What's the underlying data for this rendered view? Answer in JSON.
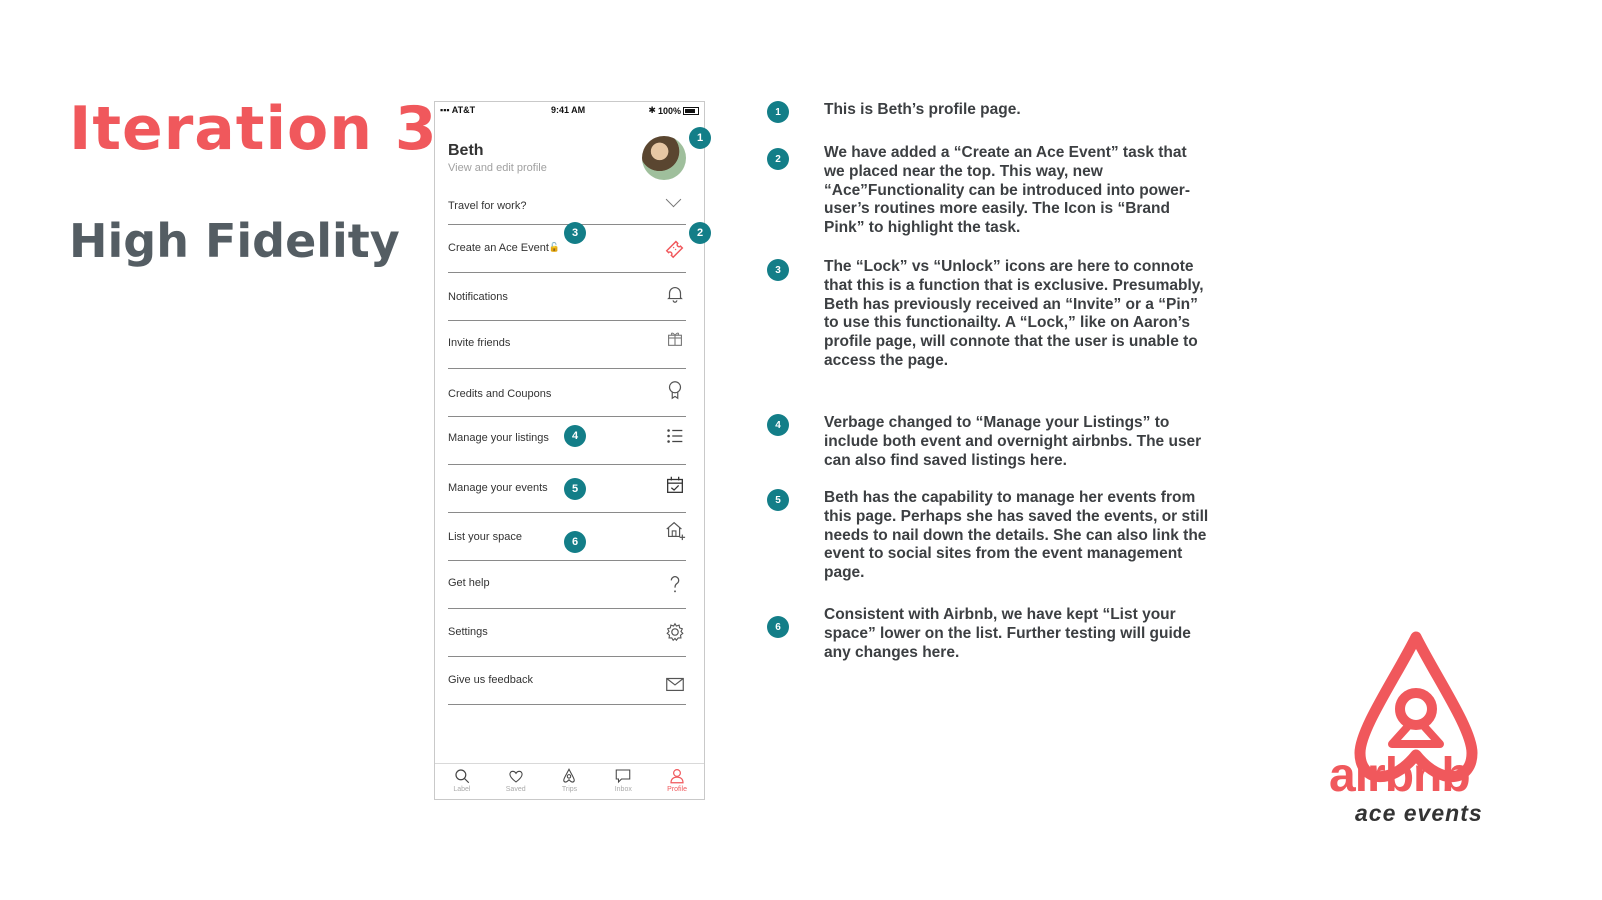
{
  "slide": {
    "title": "Iteration 3",
    "subtitle": "High Fidelity"
  },
  "phone": {
    "status": {
      "carrier": "AT&T",
      "time": "9:41 AM",
      "battery": "100%"
    },
    "profile": {
      "name": "Beth",
      "subtitle": "View and edit profile"
    },
    "travel_label": "Travel for work?",
    "menu": [
      {
        "label": "Create an Ace Event",
        "icon": "ticket-icon"
      },
      {
        "label": "Notifications",
        "icon": "bell-icon"
      },
      {
        "label": "Invite friends",
        "icon": "gift-icon"
      },
      {
        "label": "Credits and Coupons",
        "icon": "award-icon"
      },
      {
        "label": "Manage your listings",
        "icon": "list-icon"
      },
      {
        "label": "Manage your events",
        "icon": "calendar-check-icon"
      },
      {
        "label": "List your space",
        "icon": "home-plus-icon"
      },
      {
        "label": "Get help",
        "icon": "question-icon"
      },
      {
        "label": "Settings",
        "icon": "gear-icon"
      },
      {
        "label": "Give us feedback",
        "icon": "mail-icon"
      }
    ],
    "tabs": [
      {
        "label": "Label",
        "icon": "search-icon"
      },
      {
        "label": "Saved",
        "icon": "heart-icon"
      },
      {
        "label": "Trips",
        "icon": "airbnb-icon"
      },
      {
        "label": "Inbox",
        "icon": "chat-icon"
      },
      {
        "label": "Profile",
        "icon": "user-icon"
      }
    ],
    "active_tab": "Profile"
  },
  "badges": [
    "1",
    "2",
    "3",
    "4",
    "5",
    "6"
  ],
  "notes": [
    {
      "number": "1",
      "text": "This is Beth’s profile page."
    },
    {
      "number": "2",
      "text": "We have added a “Create an Ace Event” task that we placed near the top. This way, new “Ace”Functionality can be introduced into power-user’s routines more easily. The Icon is “Brand Pink” to highlight the task."
    },
    {
      "number": "3",
      "text": "The “Lock” vs “Unlock” icons are here to connote that this is a function that is exclusive. Presumably, Beth has previously received an “Invite” or a “Pin” to use this functionailty. A “Lock,” like on Aaron’s profile page, will connote that the user is unable to access the page."
    },
    {
      "number": "4",
      "text": "Verbage changed to “Manage your Listings” to include both event and overnight airbnbs. The user can also find saved listings here."
    },
    {
      "number": "5",
      "text": "Beth has the capability to manage her events from this page. Perhaps she has saved the events, or still needs to nail down the details. She can also link the event to social sites from the event management page."
    },
    {
      "number": "6",
      "text": "Consistent with Airbnb, we have kept “List your space” lower on the list. Further testing will guide any changes here."
    }
  ],
  "logo": {
    "word": "airbnb",
    "tagline": "ace events"
  },
  "colors": {
    "brand_pink": "#f0585c",
    "badge_teal": "#137e88",
    "subtitle_gray": "#545d63"
  }
}
